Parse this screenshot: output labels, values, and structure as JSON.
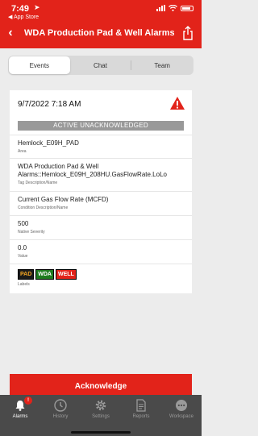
{
  "status_bar": {
    "time": "7:49",
    "back_app": "◀ App Store"
  },
  "nav": {
    "title": "WDA Production Pad & Well Alarms:...",
    "back_icon": "chevron-left-icon",
    "share_icon": "share-icon"
  },
  "tabs": [
    {
      "label": "Events",
      "active": true
    },
    {
      "label": "Chat",
      "active": false
    },
    {
      "label": "Team",
      "active": false
    }
  ],
  "event": {
    "datetime": "9/7/2022 7:18 AM",
    "status": "ACTIVE UNACKNOWLEDGED",
    "fields": [
      {
        "value": "Hemlock_E09H_PAD",
        "label": "Area"
      },
      {
        "value": "WDA Production Pad & Well Alarms::Hemlock_E09H_208HU.GasFlowRate.LoLo",
        "label": "Tag Description/Name"
      },
      {
        "value": "Current Gas Flow Rate (MCFD)",
        "label": "Condition Description/Name"
      },
      {
        "value": "500",
        "label": "Native Severity"
      },
      {
        "value": "0.0",
        "label": "Value"
      }
    ],
    "chips": [
      {
        "text": "PAD",
        "bg": "#1a1a1a",
        "fg": "#f5a623"
      },
      {
        "text": "WDA",
        "bg": "#1e7b1e",
        "fg": "#ffffff"
      },
      {
        "text": "WELL",
        "bg": "#e2231a",
        "fg": "#ffffff"
      }
    ],
    "labels_caption": "Labels"
  },
  "acknowledge_label": "Acknowledge",
  "tabbar": [
    {
      "label": "Alarms",
      "icon": "bell-icon",
      "active": true,
      "badge": "!"
    },
    {
      "label": "History",
      "icon": "clock-icon",
      "active": false
    },
    {
      "label": "Settings",
      "icon": "gear-icon",
      "active": false
    },
    {
      "label": "Reports",
      "icon": "document-icon",
      "active": false
    },
    {
      "label": "Workspace",
      "icon": "ellipsis-icon",
      "active": false
    }
  ],
  "colors": {
    "brand_red": "#e2231a",
    "tabbar_bg": "#4a4a4a",
    "page_bg": "#ececec",
    "status_banner": "#999999"
  }
}
